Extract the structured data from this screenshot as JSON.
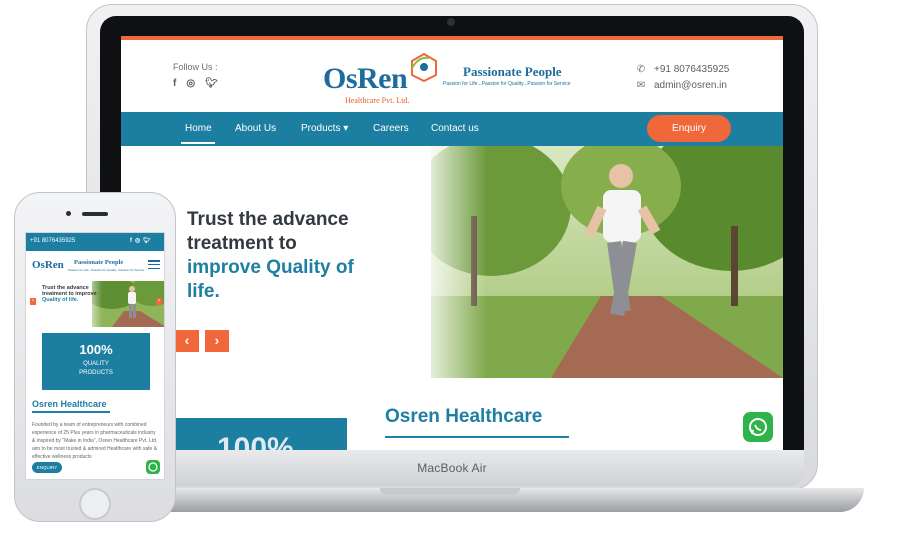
{
  "device": {
    "laptop_label": "MacBook Air"
  },
  "site": {
    "follow_label": "Follow Us :",
    "social_icons": [
      "facebook-icon",
      "instagram-icon",
      "twitter-icon"
    ],
    "logo": {
      "name": "OsRen",
      "subtitle": "Healthcare Pvt. Ltd."
    },
    "slogan": "Passionate People",
    "tagline": "Passion for Life...Passion for Quality...Passion for Service",
    "contact": {
      "phone": "+91 8076435925",
      "email": "admin@osren.in"
    },
    "nav": {
      "items": [
        {
          "label": "Home",
          "active": true
        },
        {
          "label": "About Us"
        },
        {
          "label": "Products ▾"
        },
        {
          "label": "Careers"
        },
        {
          "label": "Contact us"
        }
      ],
      "enquiry_label": "Enquiry"
    },
    "hero": {
      "line1": "Trust the advance",
      "line2": "treatment to",
      "line3": "improve Quality of",
      "line4": "life.",
      "prev_label": "‹",
      "next_label": "›"
    },
    "section": {
      "title": "Osren Healthcare",
      "stat_partial": "100%"
    },
    "colors": {
      "primary": "#1c7ea0",
      "accent": "#f0673a",
      "whatsapp": "#2fb34a"
    }
  },
  "mobile": {
    "phone": "+91 8076435925",
    "hero_lines": [
      "Trust the advance",
      "treatment to improve",
      "Quality of life."
    ],
    "stat": {
      "value": "100%",
      "line1": "QUALITY",
      "line2": "PRODUCTS"
    },
    "section_title": "Osren Healthcare",
    "body_text": "Founded by a team of entrepreneurs with combined experience of 25 Plus years in pharmaceuticals industry & inspired by \"Make in India\", Osren Healthcare Pvt. Ltd. aim to be most trusted & admired Healthcare with safe & effective wellness products",
    "enquiry_label": "ENQUIRY"
  }
}
